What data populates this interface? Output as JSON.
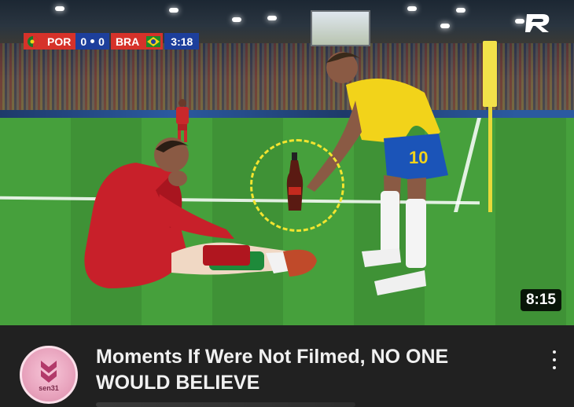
{
  "scoreboard": {
    "home_team": "POR",
    "home_score": "0",
    "away_score": "0",
    "away_team": "BRA",
    "clock": "3:18",
    "colors": {
      "home": "#d6322a",
      "away": "#d6322a",
      "score_bg": "#1d3f9c"
    }
  },
  "thumbnail": {
    "player_number": "10",
    "duration": "8:15",
    "highlight_color": "#f2e42f"
  },
  "video": {
    "title": "Moments If Were Not Filmed, NO ONE WOULD BELIEVE",
    "channel_avatar_label": "sen31",
    "menu_icon": "more-vert-icon",
    "channel_icon": "chevron-logo-icon"
  },
  "icons": {
    "watermark": "r-logo-icon"
  }
}
